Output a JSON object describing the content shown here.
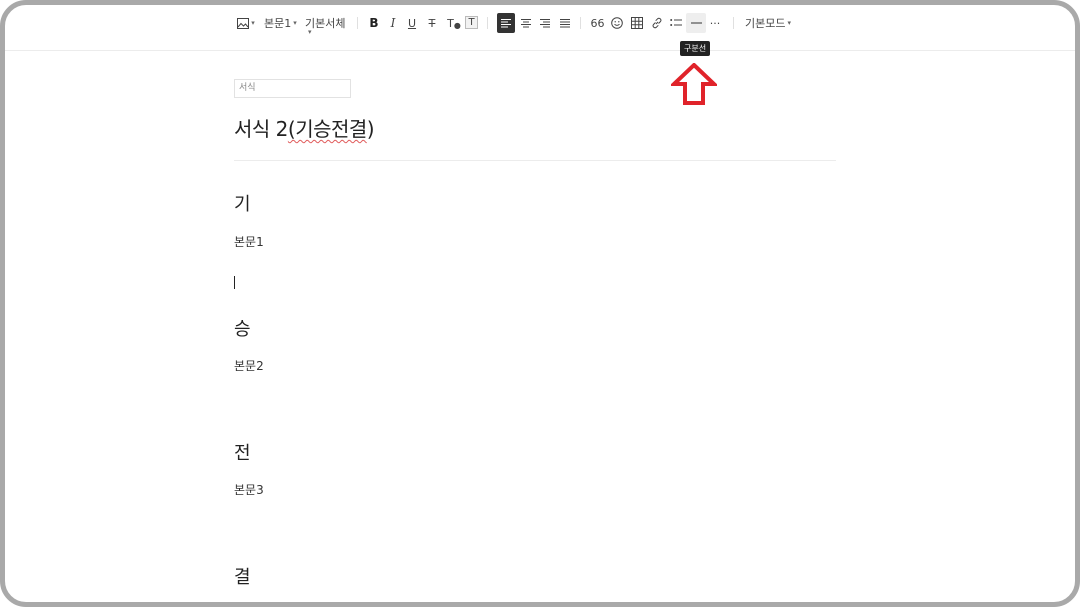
{
  "toolbar": {
    "image_icon": "image-icon",
    "paragraph_style": "본문1",
    "font_family": "기본서체",
    "bold": "B",
    "italic": "I",
    "underline": "U",
    "strike": "T",
    "text_color": "T",
    "text_bg": "T",
    "quote": "66",
    "more": "···",
    "mode": "기본모드",
    "tooltip": "구분선"
  },
  "document": {
    "category_placeholder": "서식",
    "title_prefix": "서식 2",
    "title_spell": "(기승전결",
    "title_suffix": ")",
    "sections": [
      {
        "heading": "기",
        "body": "본문1"
      },
      {
        "heading": "승",
        "body": "본문2"
      },
      {
        "heading": "전",
        "body": "본문3"
      },
      {
        "heading": "결",
        "body": ""
      }
    ]
  },
  "colors": {
    "arrow": "#e0232a",
    "active_align": "#333333",
    "frame": "#a9a9a9"
  }
}
